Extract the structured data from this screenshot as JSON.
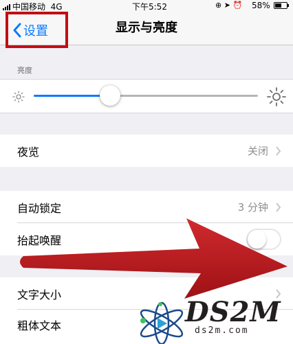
{
  "status_bar": {
    "carrier": "中国移动",
    "network": "4G",
    "time": "下午5:52",
    "icons": [
      "orientation-lock-icon",
      "location-icon",
      "alarm-icon"
    ],
    "battery_percent": "58%",
    "battery_level": 0.58
  },
  "nav": {
    "back_label": "设置",
    "title": "显示与亮度"
  },
  "brightness": {
    "section_header": "亮度",
    "level": 0.34
  },
  "settings": {
    "night_shift": {
      "label": "夜览",
      "value": "关闭"
    },
    "auto_lock": {
      "label": "自动锁定",
      "value": "3 分钟"
    },
    "raise_to_wake": {
      "label": "抬起唤醒",
      "on": false
    },
    "text_size": {
      "label": "文字大小"
    },
    "bold_text": {
      "label": "粗体文本"
    }
  },
  "watermark": {
    "brand": "DS2M",
    "domain": "ds2m.com"
  },
  "colors": {
    "accent": "#0a7aff",
    "highlight_box": "#c20e14",
    "arrow": "#b5161b"
  }
}
